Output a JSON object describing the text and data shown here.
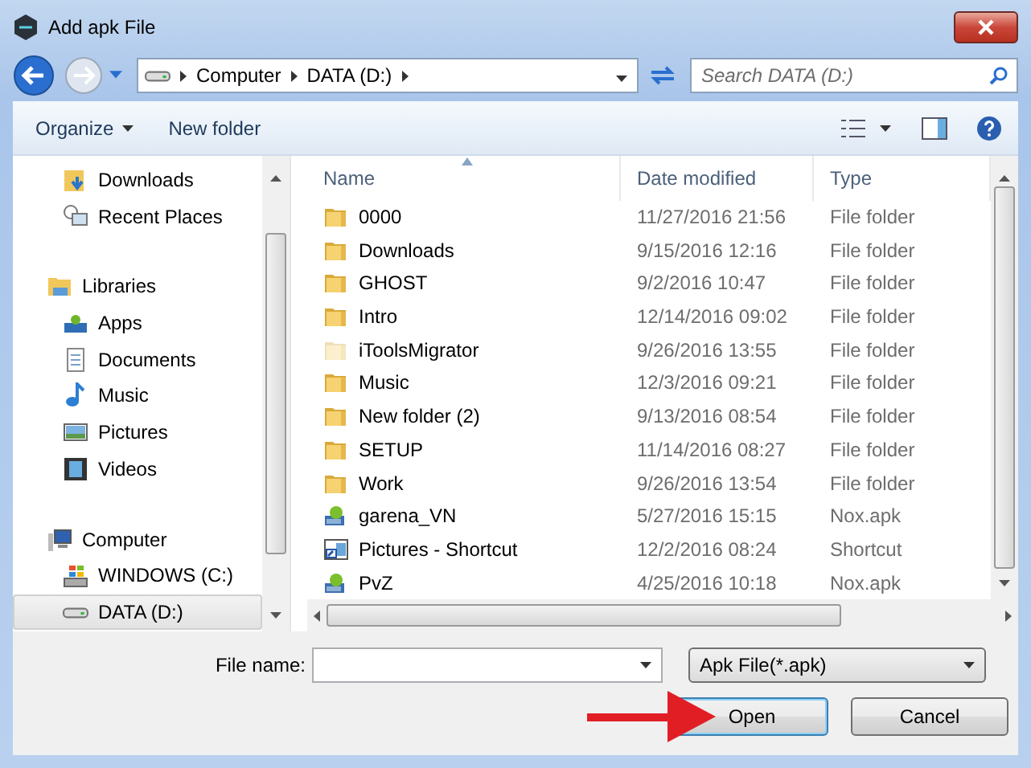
{
  "window": {
    "title": "Add apk File"
  },
  "address": {
    "crumbs": [
      "Computer",
      "DATA (D:)"
    ]
  },
  "search": {
    "placeholder": "Search DATA (D:)"
  },
  "toolbar": {
    "buttons": [
      "Organize",
      "New folder"
    ]
  },
  "sidebar": {
    "sections": [
      {
        "items": [
          {
            "label": "Downloads",
            "kind": "downloads",
            "selected": false
          },
          {
            "label": "Recent Places",
            "kind": "recent",
            "selected": false
          }
        ]
      },
      {
        "label": "Libraries",
        "kind": "library",
        "items": [
          {
            "label": "Apps",
            "kind": "apps",
            "selected": false
          },
          {
            "label": "Documents",
            "kind": "documents",
            "selected": false
          },
          {
            "label": "Music",
            "kind": "music",
            "selected": false
          },
          {
            "label": "Pictures",
            "kind": "pictures",
            "selected": false
          },
          {
            "label": "Videos",
            "kind": "videos",
            "selected": false
          }
        ]
      },
      {
        "label": "Computer",
        "kind": "computer",
        "items": [
          {
            "label": "WINDOWS (C:)",
            "kind": "windows",
            "selected": false
          },
          {
            "label": "DATA (D:)",
            "kind": "drive",
            "selected": true
          }
        ]
      }
    ]
  },
  "table": {
    "columns": [
      "Name",
      "Date modified",
      "Type"
    ],
    "rows": [
      {
        "kind": "folder",
        "hidden": false,
        "name": "0000",
        "date": "11/27/2016 21:56",
        "type": "File folder"
      },
      {
        "kind": "folder",
        "hidden": false,
        "name": "Downloads",
        "date": "9/15/2016 12:16",
        "type": "File folder"
      },
      {
        "kind": "folder",
        "hidden": false,
        "name": "GHOST",
        "date": "9/2/2016 10:47",
        "type": "File folder"
      },
      {
        "kind": "folder",
        "hidden": false,
        "name": "Intro",
        "date": "12/14/2016 09:02",
        "type": "File folder"
      },
      {
        "kind": "folder",
        "hidden": true,
        "name": "iToolsMigrator",
        "date": "9/26/2016 13:55",
        "type": "File folder"
      },
      {
        "kind": "folder",
        "hidden": false,
        "name": "Music",
        "date": "12/3/2016 09:21",
        "type": "File folder"
      },
      {
        "kind": "folder",
        "hidden": false,
        "name": "New folder (2)",
        "date": "9/13/2016 08:54",
        "type": "File folder"
      },
      {
        "kind": "folder",
        "hidden": false,
        "name": "SETUP",
        "date": "11/14/2016 08:27",
        "type": "File folder"
      },
      {
        "kind": "folder",
        "hidden": false,
        "name": "Work",
        "date": "9/26/2016 13:54",
        "type": "File folder"
      },
      {
        "kind": "apk",
        "hidden": false,
        "name": "garena_VN",
        "date": "5/27/2016 15:15",
        "type": "Nox.apk"
      },
      {
        "kind": "shortcut",
        "hidden": false,
        "name": "Pictures - Shortcut",
        "date": "12/2/2016 08:24",
        "type": "Shortcut"
      },
      {
        "kind": "apk",
        "hidden": false,
        "name": "PvZ",
        "date": "4/25/2016 10:18",
        "type": "Nox.apk"
      }
    ]
  },
  "file_name": {
    "label": "File name:"
  },
  "filter": {
    "value": "Apk File(*.apk)"
  },
  "buttons": [
    {
      "label": "Open",
      "default": true
    },
    {
      "label": "Cancel",
      "default": false
    }
  ]
}
